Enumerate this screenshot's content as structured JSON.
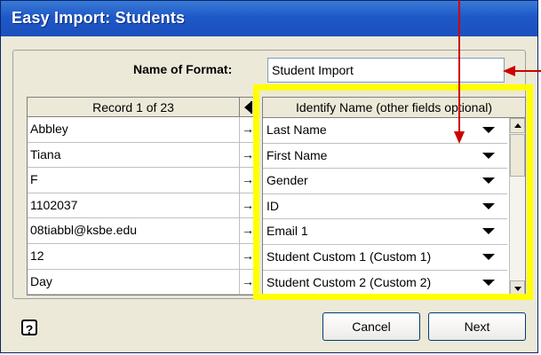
{
  "window": {
    "title": "Easy Import: Students"
  },
  "format": {
    "label": "Name of Format:",
    "value": "Student Import"
  },
  "record": {
    "header": "Record 1 of 23"
  },
  "mapping": {
    "header": "Identify Name (other fields optional)"
  },
  "rows": [
    {
      "value": "Abbley",
      "field": "Last Name"
    },
    {
      "value": "Tiana",
      "field": "First Name"
    },
    {
      "value": "F",
      "field": "Gender"
    },
    {
      "value": "1102037",
      "field": "ID"
    },
    {
      "value": "08tiabbl@ksbe.edu",
      "field": "Email 1"
    },
    {
      "value": "12",
      "field": "Student Custom 1 (Custom 1)"
    },
    {
      "value": "Day",
      "field": "Student Custom 2 (Custom 2)"
    }
  ],
  "buttons": {
    "help": "?",
    "cancel": "Cancel",
    "next": "Next"
  },
  "colors": {
    "title_bar": "#1e58c8",
    "highlight": "#ffff00",
    "annotation": "#cc0000"
  }
}
